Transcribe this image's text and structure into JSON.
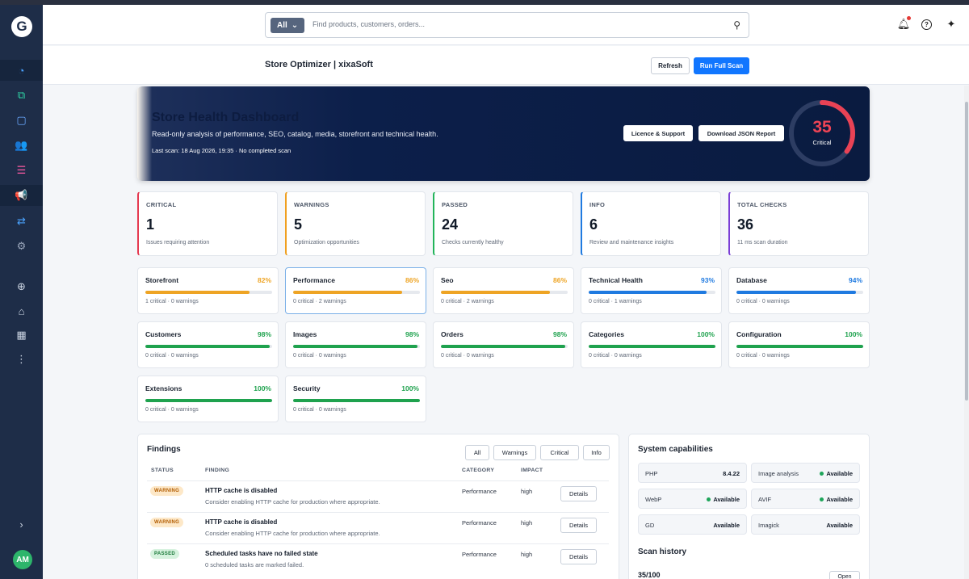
{
  "sidebar": {
    "logo": "G",
    "avatar_initials": "AM",
    "icons": [
      {
        "name": "dashboard-icon",
        "glyph": "◔",
        "color": "#4aa3ff"
      },
      {
        "name": "catalog-icon",
        "glyph": "⧉",
        "color": "#2fd3a5"
      },
      {
        "name": "orders-icon",
        "glyph": "▢",
        "color": "#6aa9ff"
      },
      {
        "name": "customers-icon",
        "glyph": "👥",
        "color": "#ff8a4c"
      },
      {
        "name": "content-icon",
        "glyph": "☰",
        "color": "#ff5aa5"
      },
      {
        "name": "marketing-icon",
        "glyph": "📢",
        "color": "#ffc629"
      },
      {
        "name": "extensions-icon",
        "glyph": "⇄",
        "color": "#4aa3ff"
      },
      {
        "name": "settings-icon",
        "glyph": "⚙",
        "color": "#9aa6bb"
      },
      {
        "name": "add-icon",
        "glyph": "⊕",
        "color": "#c9d2e0"
      },
      {
        "name": "store-icon",
        "glyph": "⌂",
        "color": "#c9d2e0"
      },
      {
        "name": "calculator-icon",
        "glyph": "▦",
        "color": "#c9d2e0"
      },
      {
        "name": "more-icon",
        "glyph": "⋮",
        "color": "#c9d2e0"
      },
      {
        "name": "expand-icon",
        "glyph": "›",
        "color": "#c9d2e0"
      }
    ]
  },
  "header": {
    "search_scope": "All",
    "search_placeholder": "Find products, customers, orders...",
    "icons": [
      "bell-icon",
      "help-icon",
      "sparkle-icon"
    ]
  },
  "subheader": {
    "title": "Store Optimizer | xixaSoft",
    "refresh_label": "Refresh",
    "scan_label": "Run Full Scan"
  },
  "hero": {
    "title": "Store Health Dashboard",
    "subtitle": "Read-only analysis of performance, SEO, catalog, media, storefront and technical health.",
    "meta": "Last scan: 18 Aug 2026, 19:35 · No completed scan",
    "licence_label": "Licence & Support",
    "download_label": "Download JSON Report",
    "score": "35",
    "score_value": 35,
    "score_label": "Critical"
  },
  "stats": [
    {
      "label": "CRITICAL",
      "value": "1",
      "desc": "Issues requiring attention",
      "color": "#e53950"
    },
    {
      "label": "WARNINGS",
      "value": "5",
      "desc": "Optimization opportunities",
      "color": "#f0a020"
    },
    {
      "label": "PASSED",
      "value": "24",
      "desc": "Checks currently healthy",
      "color": "#22b45a"
    },
    {
      "label": "INFO",
      "value": "6",
      "desc": "Review and maintenance insights",
      "color": "#1f7ae0"
    },
    {
      "label": "TOTAL CHECKS",
      "value": "36",
      "desc": "11 ms scan duration",
      "color": "#7b3fd6"
    }
  ],
  "categories": [
    {
      "name": "Storefront",
      "pct": "82%",
      "value": 82,
      "meta": "1 critical · 0 warnings",
      "color": "#eea424"
    },
    {
      "name": "Performance",
      "pct": "86%",
      "value": 86,
      "meta": "0 critical · 2 warnings",
      "color": "#eea424"
    },
    {
      "name": "Seo",
      "pct": "86%",
      "value": 86,
      "meta": "0 critical · 2 warnings",
      "color": "#eea424"
    },
    {
      "name": "Technical Health",
      "pct": "93%",
      "value": 93,
      "meta": "0 critical · 1 warnings",
      "color": "#1f7ae0"
    },
    {
      "name": "Database",
      "pct": "94%",
      "value": 94,
      "meta": "0 critical · 0 warnings",
      "color": "#1f7ae0"
    },
    {
      "name": "Customers",
      "pct": "98%",
      "value": 98,
      "meta": "0 critical · 0 warnings",
      "color": "#1fa24e"
    },
    {
      "name": "Images",
      "pct": "98%",
      "value": 98,
      "meta": "0 critical · 0 warnings",
      "color": "#1fa24e"
    },
    {
      "name": "Orders",
      "pct": "98%",
      "value": 98,
      "meta": "0 critical · 0 warnings",
      "color": "#1fa24e"
    },
    {
      "name": "Categories",
      "pct": "100%",
      "value": 100,
      "meta": "0 critical · 0 warnings",
      "color": "#1fa24e"
    },
    {
      "name": "Configuration",
      "pct": "100%",
      "value": 100,
      "meta": "0 critical · 0 warnings",
      "color": "#1fa24e"
    },
    {
      "name": "Extensions",
      "pct": "100%",
      "value": 100,
      "meta": "0 critical · 0 warnings",
      "color": "#1fa24e"
    },
    {
      "name": "Security",
      "pct": "100%",
      "value": 100,
      "meta": "0 critical · 0 warnings",
      "color": "#1fa24e"
    }
  ],
  "findings": {
    "title": "Findings",
    "filters": [
      "All",
      "Warnings",
      "Critical",
      "Info"
    ],
    "columns": [
      "STATUS",
      "FINDING",
      "CATEGORY",
      "IMPACT"
    ],
    "details_label": "Details",
    "rows": [
      {
        "status": "WARNING",
        "title": "HTTP cache is disabled",
        "desc": "Consider enabling HTTP cache for production where appropriate.",
        "category": "Performance",
        "impact": "high"
      },
      {
        "status": "WARNING",
        "title": "HTTP cache is disabled",
        "desc": "Consider enabling HTTP cache for production where appropriate.",
        "category": "Performance",
        "impact": "high"
      },
      {
        "status": "PASSED",
        "title": "Scheduled tasks have no failed state",
        "desc": "0 scheduled tasks are marked failed.",
        "category": "Performance",
        "impact": "high"
      }
    ]
  },
  "capabilities": {
    "title": "System capabilities",
    "items": [
      {
        "name": "PHP",
        "value": "8.4.22",
        "dot": false
      },
      {
        "name": "Image analysis",
        "value": "Available",
        "dot": true
      },
      {
        "name": "WebP",
        "value": "Available",
        "dot": true
      },
      {
        "name": "AVIF",
        "value": "Available",
        "dot": true
      },
      {
        "name": "GD",
        "value": "Available",
        "dot": false
      },
      {
        "name": "Imagick",
        "value": "Available",
        "dot": false
      }
    ],
    "history_title": "Scan history",
    "history_value": "35/100",
    "history_button": "Open"
  }
}
